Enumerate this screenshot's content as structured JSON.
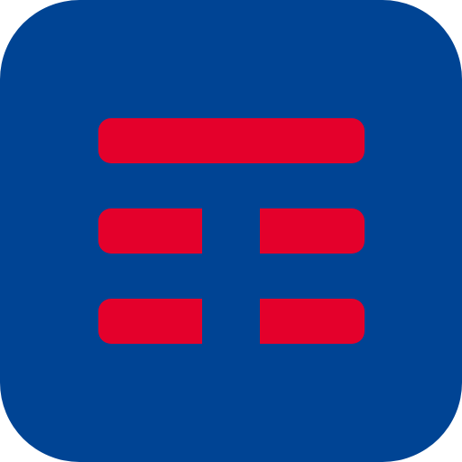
{
  "app_icon": {
    "icon": "tim-logo-icon",
    "colors": {
      "background": "#004494",
      "mark": "#e4002b"
    }
  }
}
